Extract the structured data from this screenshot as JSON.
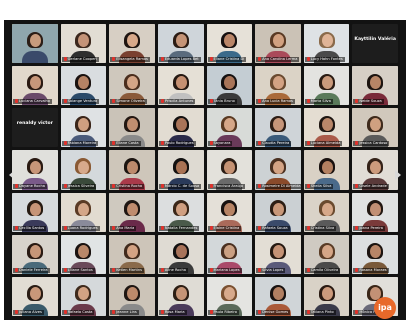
{
  "app": {
    "logo_text": "ipa"
  },
  "colors": {
    "background": "#121212",
    "active_speaker": "#f3c623",
    "muted_mic": "#e0312b",
    "logo": "#e8692a"
  },
  "icons": {
    "prev": "chevron-left-icon",
    "next": "chevron-right-icon",
    "mic": "mic-muted-icon"
  },
  "grid": {
    "columns": 8,
    "rows": 7,
    "page_count": 2
  },
  "participants": [
    {
      "name": "",
      "video": true,
      "wall": "#8fa6ad",
      "skin": "#c79b7d",
      "hair": "#2b1d16",
      "shirt": "#3a4a6a"
    },
    {
      "name": "Gerlane Cooperi",
      "video": true,
      "wall": "#e2ddd4",
      "skin": "#c49378",
      "hair": "#3a261c",
      "shirt": "#2e2e2e"
    },
    {
      "name": "Elisangela Ramos",
      "video": true,
      "wall": "#d7cfc4",
      "skin": "#d8a98a",
      "hair": "#1e1410",
      "shirt": "#7a4030"
    },
    {
      "name": "Eduarda Lopes Bet",
      "video": true,
      "wall": "#cfd5da",
      "skin": "#c59477",
      "hair": "#2b1b13",
      "shirt": "#5a6b7d"
    },
    {
      "name": "Eliane Cristina Di",
      "video": true,
      "wall": "#e6e1d8",
      "skin": "#b98568",
      "hair": "#161010",
      "shirt": "#3b6a8a"
    },
    {
      "name": "Ana Carolina Lerma",
      "video": true,
      "wall": "#cbc2b6",
      "skin": "#d2a180",
      "hair": "#5a3a24",
      "shirt": "#aa4a5a"
    },
    {
      "name": "Lucy Hahn Fontes",
      "video": true,
      "wall": "#dee2e5",
      "skin": "#e0b496",
      "hair": "#8a6a4a",
      "shirt": "#4a4a4a"
    },
    {
      "name": "Kayttilin Valéria",
      "video": false,
      "wall": "#1d1d1d",
      "skin": "#1d1d1d",
      "hair": "#1d1d1d",
      "shirt": "#1d1d1d"
    },
    {
      "name": "Luciana Carvalho",
      "video": true,
      "wall": "#e1d8cb",
      "skin": "#c8977a",
      "hair": "#2a1a12",
      "shirt": "#6a4a6a"
    },
    {
      "name": "Solange Ventura",
      "video": true,
      "wall": "#d9dde0",
      "skin": "#b68264",
      "hair": "#1a1210",
      "shirt": "#2a4a6a"
    },
    {
      "name": "Simone Oliveira",
      "video": true,
      "wall": "#cfc8bd",
      "skin": "#d4a586",
      "hair": "#4a2e1e",
      "shirt": "#8a5a3a"
    },
    {
      "name": "Priscila Antunes",
      "video": true,
      "wall": "#e5e0d6",
      "skin": "#c59072",
      "hair": "#241812",
      "shirt": "#c0c0c0"
    },
    {
      "name": "Tânia Bruno",
      "video": true,
      "wall": "#c4cdd3",
      "skin": "#a87458",
      "hair": "#141010",
      "shirt": "#3a3a3a"
    },
    {
      "name": "Ana Lucia Ramos",
      "video": true,
      "wall": "#dbd3c6",
      "skin": "#d3a283",
      "hair": "#6a4a30",
      "shirt": "#aa6a3a"
    },
    {
      "name": "Marta Silva",
      "video": true,
      "wall": "#e3e3e0",
      "skin": "#c99a7c",
      "hair": "#2a1c14",
      "shirt": "#5a7a5a"
    },
    {
      "name": "Neide Souza",
      "video": true,
      "wall": "#d6cfc6",
      "skin": "#b78566",
      "hair": "#1c1410",
      "shirt": "#7a2a3a"
    },
    {
      "name": "renaldy victor",
      "video": false,
      "wall": "#1d1d1d",
      "skin": "#1d1d1d",
      "hair": "#1d1d1d",
      "shirt": "#1d1d1d"
    },
    {
      "name": "Fabiana Moreira",
      "video": true,
      "wall": "#dfe2e4",
      "skin": "#cf9f80",
      "hair": "#3a2418",
      "shirt": "#4a5a7a"
    },
    {
      "name": "Eliane Costa",
      "video": true,
      "wall": "#cac3b8",
      "skin": "#c18e70",
      "hair": "#221712",
      "shirt": "#8a8a8a"
    },
    {
      "name": "Paulo Rodrigues",
      "video": true,
      "wall": "#e2dcd2",
      "skin": "#a97459",
      "hair": "#121010",
      "shirt": "#2a2a4a"
    },
    {
      "name": "Sayonara",
      "video": true,
      "wall": "#d8dbd8",
      "skin": "#d6a788",
      "hair": "#5a3a22",
      "shirt": "#6a3a5a"
    },
    {
      "name": "Claudia Pereira",
      "video": true,
      "wall": "#cfd4d8",
      "skin": "#c69579",
      "hair": "#2c1c14",
      "shirt": "#3a5a7a"
    },
    {
      "name": "Luciana Almeida",
      "video": true,
      "wall": "#e4ddd2",
      "skin": "#b9876a",
      "hair": "#1e1612",
      "shirt": "#aa5a4a"
    },
    {
      "name": "Jessica Cardoso",
      "video": true,
      "wall": "#d1c8bc",
      "skin": "#d0a080",
      "hair": "#3e2a1c",
      "shirt": "#5a5a5a"
    },
    {
      "name": "Dayane Rocha",
      "video": true,
      "wall": "#e0e0dc",
      "skin": "#c89679",
      "hair": "#2a1a12",
      "shirt": "#7a5a8a"
    },
    {
      "name": "Jessica Silveira",
      "video": true,
      "wall": "#d4d9dc",
      "skin": "#d7aa8c",
      "hair": "#8a5a34",
      "shirt": "#3a4a3a"
    },
    {
      "name": "Cristina Rocha",
      "video": true,
      "wall": "#cec6ba",
      "skin": "#bd8a6c",
      "hair": "#1c1410",
      "shirt": "#aa3a4a"
    },
    {
      "name": "Márcio C. de Sousa",
      "video": true,
      "wall": "#dedad2",
      "skin": "#a87254",
      "hair": "#121010",
      "shirt": "#2a3a5a"
    },
    {
      "name": "Francisca Araújo",
      "video": true,
      "wall": "#e3e1db",
      "skin": "#c59273",
      "hair": "#2a1c14",
      "shirt": "#6a6a6a"
    },
    {
      "name": "Rosimeire Di Almeida",
      "video": true,
      "wall": "#cdd2d4",
      "skin": "#d4a485",
      "hair": "#4a3020",
      "shirt": "#8a4a2a"
    },
    {
      "name": "Sheila Silva",
      "video": true,
      "wall": "#d9d1c5",
      "skin": "#b38061",
      "hair": "#1a1210",
      "shirt": "#4a6a8a"
    },
    {
      "name": "Gisele Andrade",
      "video": true,
      "wall": "#e1ddd6",
      "skin": "#cc9b7d",
      "hair": "#342218",
      "shirt": "#5a3a3a"
    },
    {
      "name": "Cecília Santos",
      "video": true,
      "wall": "#d6dadd",
      "skin": "#c69477",
      "hair": "#261a12",
      "shirt": "#3a3a5a"
    },
    {
      "name": "Luana Rodrigues",
      "video": true,
      "wall": "#e2dbd0",
      "skin": "#d4a688",
      "hair": "#5a3a24",
      "shirt": "#8a8a9a"
    },
    {
      "name": "Ana Maria",
      "video": true,
      "wall": "#cfc9bf",
      "skin": "#bf8c6e",
      "hair": "#1e1612",
      "shirt": "#6a2a4a"
    },
    {
      "name": "Natalia Fernandes",
      "video": true,
      "wall": "#dcdedf",
      "skin": "#d09f81",
      "hair": "#3a2618",
      "shirt": "#4a5a4a"
    },
    {
      "name": "Elaine Cristina",
      "video": true,
      "wall": "#e4e0d8",
      "skin": "#b78465",
      "hair": "#181210",
      "shirt": "#aa6a5a"
    },
    {
      "name": "Rafaela Souza",
      "video": true,
      "wall": "#cbd0d3",
      "skin": "#c99879",
      "hair": "#2c1e14",
      "shirt": "#3a4a6a"
    },
    {
      "name": "Cristina Silva",
      "video": true,
      "wall": "#dad3c8",
      "skin": "#d6a889",
      "hair": "#6a4a2e",
      "shirt": "#5a5a5a"
    },
    {
      "name": "Joana Pereira",
      "video": true,
      "wall": "#e0e2e2",
      "skin": "#c29074",
      "hair": "#221812",
      "shirt": "#7a3a3a"
    },
    {
      "name": "Daniele Ferreira",
      "video": true,
      "wall": "#d8d3cb",
      "skin": "#c79678",
      "hair": "#2a1a12",
      "shirt": "#4a6a7a"
    },
    {
      "name": "Liliane Santos",
      "video": true,
      "wall": "#e1e4e5",
      "skin": "#b98769",
      "hair": "#1a1210",
      "shirt": "#6a4a5a"
    },
    {
      "name": "Ketlen Martins",
      "video": true,
      "wall": "#cdc5b9",
      "skin": "#d3a384",
      "hair": "#402a1c",
      "shirt": "#8a6a4a"
    },
    {
      "name": "Aline Rocha",
      "video": true,
      "wall": "#dfdbd3",
      "skin": "#a8735a",
      "hair": "#121010",
      "shirt": "#3a3a3a"
    },
    {
      "name": "Mariana Lopes",
      "video": true,
      "wall": "#d3d8da",
      "skin": "#caa082",
      "hair": "#4a3020",
      "shirt": "#aa4a6a"
    },
    {
      "name": "Silvia Lopes",
      "video": true,
      "wall": "#e3ded5",
      "skin": "#c49275",
      "hair": "#261a12",
      "shirt": "#5a5a7a"
    },
    {
      "name": "Camila Oliveira",
      "video": true,
      "wall": "#cfcac2",
      "skin": "#d5a687",
      "hair": "#5a3c26",
      "shirt": "#4a4a4a"
    },
    {
      "name": "Rosana Moraes",
      "video": true,
      "wall": "#dcdfe0",
      "skin": "#b88567",
      "hair": "#1c1410",
      "shirt": "#7a5a3a"
    },
    {
      "name": "Juliana Alves",
      "video": true,
      "wall": "#e2ddd4",
      "skin": "#c99779",
      "hair": "#2a1c14",
      "shirt": "#3a5a6a"
    },
    {
      "name": "Rafaela Costa",
      "video": true,
      "wall": "#d5d9db",
      "skin": "#d2a283",
      "hair": "#3e2a1c",
      "shirt": "#6a3a4a"
    },
    {
      "name": "Jeanne Lins",
      "video": true,
      "wall": "#ccc4b8",
      "skin": "#bd8a6b",
      "hair": "#1e1612",
      "shirt": "#8a8a8a"
    },
    {
      "name": "Rosa Maria",
      "video": true,
      "wall": "#dfdcd5",
      "skin": "#c69476",
      "hair": "#2c1e14",
      "shirt": "#4a3a5a"
    },
    {
      "name": "Paula Ribeiro",
      "video": true,
      "wall": "#e4e4e1",
      "skin": "#d7a98b",
      "hair": "#7a5030",
      "shirt": "#5a6a5a"
    },
    {
      "name": "Denise Gomes",
      "video": true,
      "wall": "#d0d5d8",
      "skin": "#b17f61",
      "hair": "#181210",
      "shirt": "#aa5a3a"
    },
    {
      "name": "Tatiana Pinto",
      "video": true,
      "wall": "#d9d2c7",
      "skin": "#cc9a7c",
      "hair": "#2a1a12",
      "shirt": "#3a3a4a"
    },
    {
      "name": "Mônica Prado",
      "video": true,
      "wall": "#e1dfda",
      "skin": "#c39175",
      "hair": "#3a2618",
      "shirt": "#6a6a7a"
    }
  ],
  "bottom_row": [
    {
      "name": "Bruna Aparecida",
      "video": false
    },
    {
      "name": "Jacqueline Lobo",
      "video": false
    },
    {
      "name": "val",
      "video": false
    },
    {
      "name": "Arali Rego",
      "video": false
    },
    {
      "name": "Ana Clara Teixeira",
      "video": false
    },
    {
      "name": "Michaane",
      "video": false
    }
  ]
}
